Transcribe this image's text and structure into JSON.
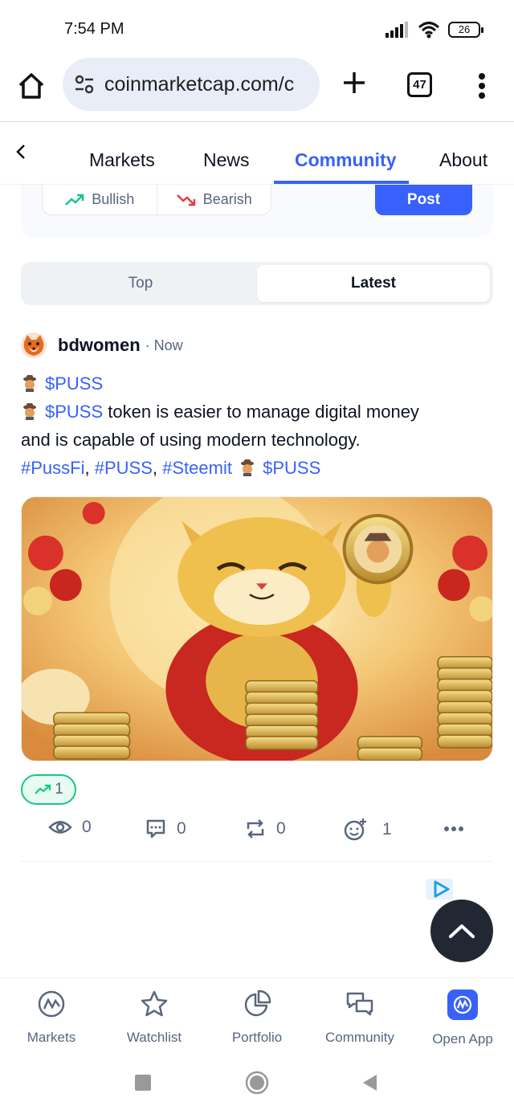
{
  "status": {
    "time": "7:54 PM",
    "battery": "26"
  },
  "browser": {
    "url": "coinmarketcap.com/c",
    "tab_count": "47"
  },
  "site_nav": {
    "tabs": [
      {
        "label": "Markets"
      },
      {
        "label": "News"
      },
      {
        "label": "Community",
        "active": true
      },
      {
        "label": "About"
      }
    ]
  },
  "sentiment": {
    "bullish": "Bullish",
    "bearish": "Bearish",
    "post": "Post"
  },
  "feed_toggle": {
    "top": "Top",
    "latest": "Latest",
    "selected": "Latest"
  },
  "post": {
    "author": "bdwomen",
    "time": "· Now",
    "ticker": "$PUSS",
    "body_text_1": " token is easier to manage digital money",
    "body_text_2": "and is capable of using modern technology.",
    "hashtags": [
      "#PussFi",
      "#PUSS",
      "#Steemit"
    ],
    "separator": ",",
    "bullish_count": "1",
    "stats": {
      "views": "0",
      "comments": "0",
      "reposts": "0",
      "reactions": "1"
    }
  },
  "bottom_nav": {
    "items": [
      {
        "label": "Markets"
      },
      {
        "label": "Watchlist"
      },
      {
        "label": "Portfolio"
      },
      {
        "label": "Community"
      },
      {
        "label": "Open App"
      }
    ]
  },
  "colors": {
    "accent": "#3861fb",
    "bullish": "#16c784",
    "bearish": "#ea3943",
    "muted": "#58667e"
  }
}
